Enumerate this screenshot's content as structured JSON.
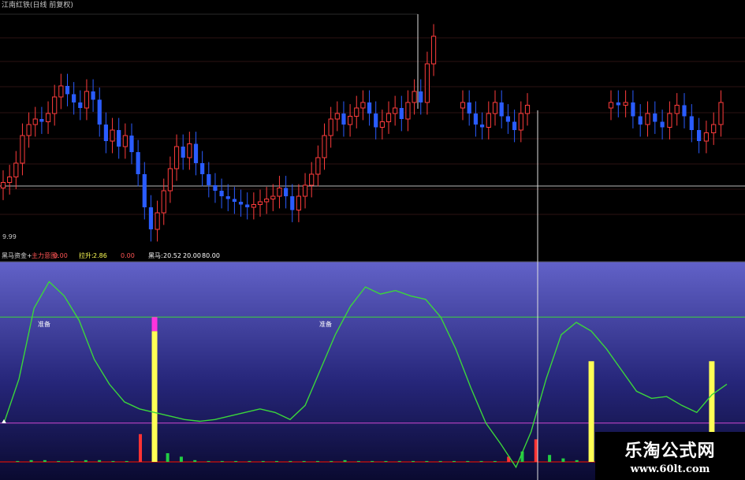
{
  "window_title": "江南红铁(日线 前复权)",
  "colors": {
    "up": "#ff3c3c",
    "down": "#2a5cff",
    "green_line": "#3bd63b",
    "magenta": "#ff33dd",
    "yellow": "#ffff55",
    "indicator_bg_top": "#6262c8",
    "indicator_bg_bottom": "#0a0a30"
  },
  "price_panel": {
    "low_label": "9.99"
  },
  "indicator_panel": {
    "name": "黑马资金+",
    "param1_label": "主力意图:",
    "param1_value": "0.00",
    "param2_label": "拉升:",
    "param2_value": "2.86",
    "param3_value": "0.00",
    "param4_label": "黑马:",
    "param4_value": "20.52",
    "param5_value": "20.00",
    "param6_value": "80.00",
    "marker_label": "准备"
  },
  "watermark": {
    "title": "乐淘公式网",
    "url": "www.60lt.com"
  },
  "chart_data": [
    {
      "type": "candlestick",
      "title": "",
      "xlabel": "",
      "ylabel": "",
      "ylim": [
        9.8,
        13.9
      ],
      "grid": false,
      "annotations": [
        "9.99"
      ],
      "segments": [
        {
          "name": "",
          "closes": [
            10.85,
            10.95,
            11.2,
            11.7,
            11.9,
            12.0,
            11.95,
            12.1,
            12.4,
            12.6,
            12.45,
            12.3,
            12.2,
            12.5,
            12.35,
            11.9,
            11.6,
            11.8,
            11.5,
            11.7,
            11.4,
            11.0,
            10.4,
            10.0,
            10.3,
            10.7,
            11.1,
            11.5,
            11.3,
            11.55,
            11.2,
            11.0,
            10.8,
            10.7,
            10.6,
            10.55,
            10.5,
            10.45,
            10.4,
            10.45,
            10.5,
            10.55,
            10.6,
            10.75,
            10.6,
            10.35,
            10.6,
            10.8,
            11.0,
            11.3,
            11.7,
            12.0,
            12.1,
            11.9,
            12.05,
            12.2,
            12.3,
            12.1,
            11.85,
            11.95,
            12.1,
            12.2,
            12.0,
            12.3,
            12.5,
            12.3,
            13.0,
            13.5
          ]
        },
        {
          "name": "",
          "closes": [
            12.3,
            12.1,
            11.9,
            11.85,
            12.1,
            12.3,
            12.05,
            11.95,
            11.8,
            12.1,
            12.25
          ]
        },
        {
          "name": "",
          "closes": [
            12.3,
            12.25,
            12.3,
            12.05,
            11.9,
            12.1,
            11.95,
            11.85,
            12.1,
            12.25,
            12.05,
            11.8,
            11.6,
            11.75,
            11.9,
            12.3
          ]
        }
      ]
    },
    {
      "type": "line",
      "title": "",
      "xlabel": "",
      "ylabel": "",
      "ylim": [
        -10,
        110
      ],
      "reference_lines": [
        80,
        20
      ],
      "series": [
        {
          "name": "",
          "values": [
            20,
            45,
            85,
            100,
            92,
            78,
            56,
            42,
            32,
            28,
            26,
            24,
            22,
            21,
            22,
            24,
            26,
            28,
            26,
            22,
            30,
            50,
            70,
            86,
            97,
            93,
            95,
            92,
            90,
            80,
            62,
            40,
            20,
            8,
            -5,
            15,
            45,
            70,
            77,
            72,
            62,
            50,
            38,
            34,
            35,
            30,
            26,
            36,
            42
          ]
        }
      ],
      "bars": [
        {
          "name": "",
          "x": [
            10,
            39,
            47
          ],
          "values": [
            72,
            55,
            55
          ],
          "top_segment": [
            80,
            0,
            0
          ]
        }
      ],
      "volume": [
        {
          "name": "",
          "values": [
            0,
            0.5,
            1,
            1,
            0.5,
            0.5,
            1,
            1,
            0.5,
            0.5,
            16,
            25,
            5,
            3,
            1,
            0.5,
            0.5,
            0.5,
            0.5,
            0.5,
            0.5,
            0.5,
            0.5,
            0.5,
            0.5,
            1,
            0.5,
            0.5,
            0.5,
            0.5,
            0.5,
            0.5,
            0.5,
            0.5,
            0.5,
            0.5,
            0.5,
            3,
            6,
            13,
            4,
            2,
            1,
            0.5,
            1,
            0.5,
            0.5,
            0.5,
            0.5,
            0.5,
            0.5,
            0.5,
            0.5,
            0.5
          ]
        }
      ]
    }
  ]
}
